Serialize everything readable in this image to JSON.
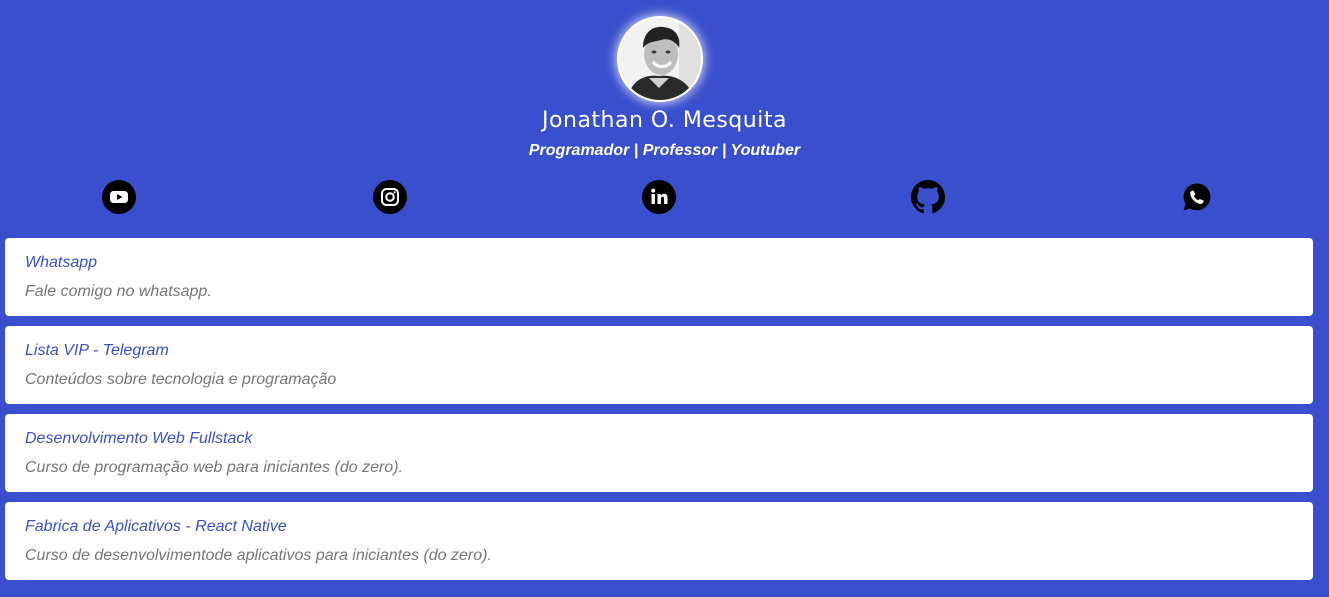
{
  "profile": {
    "name": "Jonathan O. Mesquita",
    "tagline": "Programador | Professor | Youtuber"
  },
  "social": [
    {
      "name": "youtube-icon"
    },
    {
      "name": "instagram-icon"
    },
    {
      "name": "linkedin-icon"
    },
    {
      "name": "github-icon"
    },
    {
      "name": "whatsapp-icon"
    }
  ],
  "links": [
    {
      "title": "Whatsapp",
      "description": "Fale comigo no whatsapp."
    },
    {
      "title": "Lista VIP - Telegram",
      "description": "Conteúdos sobre tecnologia e programação"
    },
    {
      "title": "Desenvolvimento Web Fullstack",
      "description": "Curso de programação web para iniciantes (do zero)."
    },
    {
      "title": "Fabrica de Aplicativos - React Native",
      "description": "Curso de desenvolvimentode aplicativos para iniciantes (do zero)."
    }
  ],
  "colors": {
    "background": "#3a4fce",
    "card": "#ffffff",
    "title": "#3a4fce",
    "description": "#777777",
    "icon": "#000000"
  }
}
